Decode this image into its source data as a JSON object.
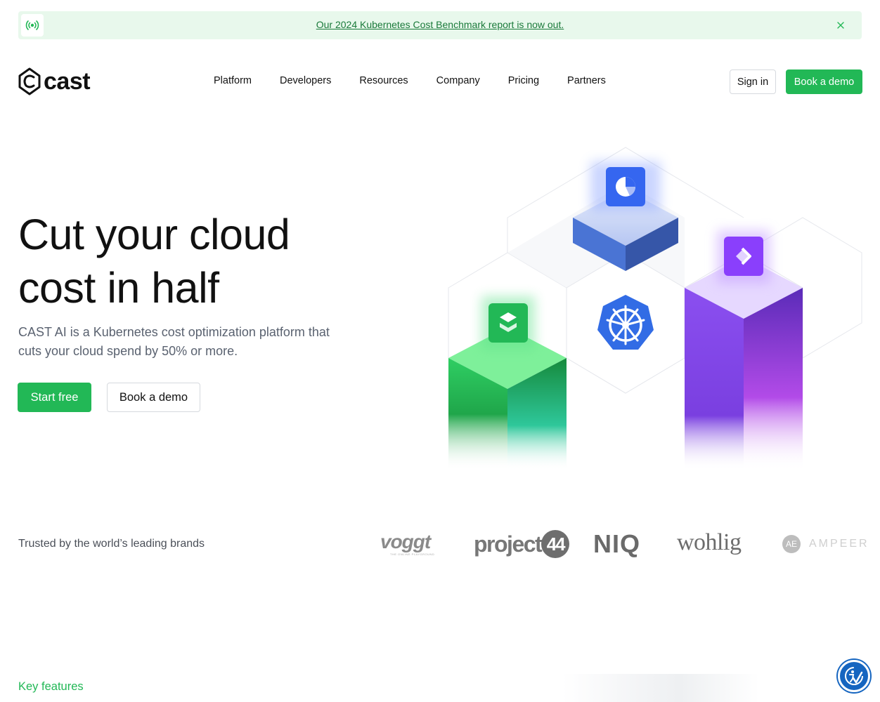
{
  "banner": {
    "link_text": "Our 2024 Kubernetes Cost Benchmark report is now out.",
    "icon": "broadcast-icon",
    "close_icon": "close-icon"
  },
  "header": {
    "logo_text": "cast",
    "nav": [
      "Platform",
      "Developers",
      "Resources",
      "Company",
      "Pricing",
      "Partners"
    ],
    "sign_in": "Sign in",
    "book_demo": "Book a demo"
  },
  "hero": {
    "title_line1": "Cut your cloud",
    "title_line2": "cost in half",
    "subtitle": "CAST AI is a Kubernetes cost optimization platform that cuts your cloud spend by 50% or more.",
    "start_free": "Start free",
    "book_demo": "Book a demo"
  },
  "trusted": {
    "label": "Trusted by the world’s leading brands",
    "brands": [
      "voggt",
      "project44",
      "NIQ",
      "wohlig",
      "AMPEER"
    ],
    "voggt_tagline": "THE ONLINE PLAYGROUND",
    "project44_prefix": "project",
    "project44_number": "44",
    "ampeer_mark": "AE"
  },
  "sections": {
    "key_features": "Key features"
  },
  "colors": {
    "brand_green": "#22b856",
    "banner_bg": "#e8f8ec",
    "kubernetes_blue": "#326ce5",
    "purple": "#8a3ffc"
  }
}
